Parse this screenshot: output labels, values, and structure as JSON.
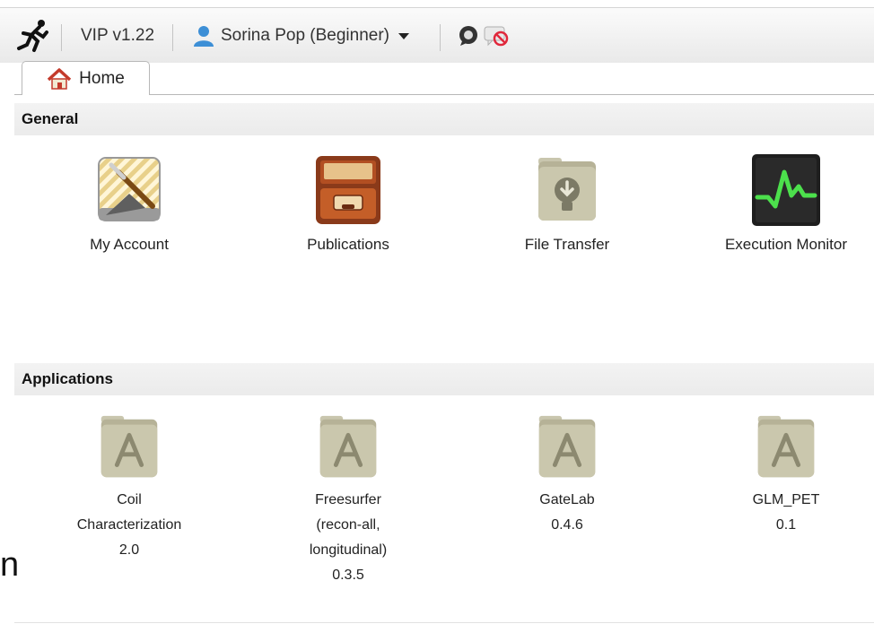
{
  "toolbar": {
    "logo_icon": "runner-logo-icon",
    "version": "VIP v1.22",
    "user": "Sorina Pop (Beginner)",
    "user_icon": "user-icon",
    "chat_icon": "chat-icon",
    "chat_off_icon": "chat-disabled-icon"
  },
  "tabs": [
    {
      "label": "Home",
      "icon": "house-icon",
      "selected": true
    }
  ],
  "general": {
    "title": "General",
    "items": [
      {
        "label": "My Account",
        "icon": "account-tools-icon"
      },
      {
        "label": "Publications",
        "icon": "file-cabinet-icon"
      },
      {
        "label": "File Transfer",
        "icon": "download-folder-icon"
      },
      {
        "label": "Execution Monitor",
        "icon": "monitor-pulse-icon"
      }
    ]
  },
  "applications": {
    "title": "Applications",
    "items": [
      {
        "lines": [
          "Coil",
          "Characterization",
          "2.0"
        ],
        "icon": "app-folder-icon"
      },
      {
        "lines": [
          "Freesurfer",
          "(recon-all,",
          "longitudinal)",
          "0.3.5"
        ],
        "icon": "app-folder-icon"
      },
      {
        "lines": [
          "GateLab",
          "0.4.6"
        ],
        "icon": "app-folder-icon"
      },
      {
        "lines": [
          "GLM_PET",
          "0.1"
        ],
        "icon": "app-folder-icon"
      }
    ]
  },
  "stray_text": "n",
  "colors": {
    "folder": "#b6b297",
    "monitor_green": "#4ce04c",
    "user_blue": "#3d8fd6",
    "house_red": "#c43a2b"
  }
}
